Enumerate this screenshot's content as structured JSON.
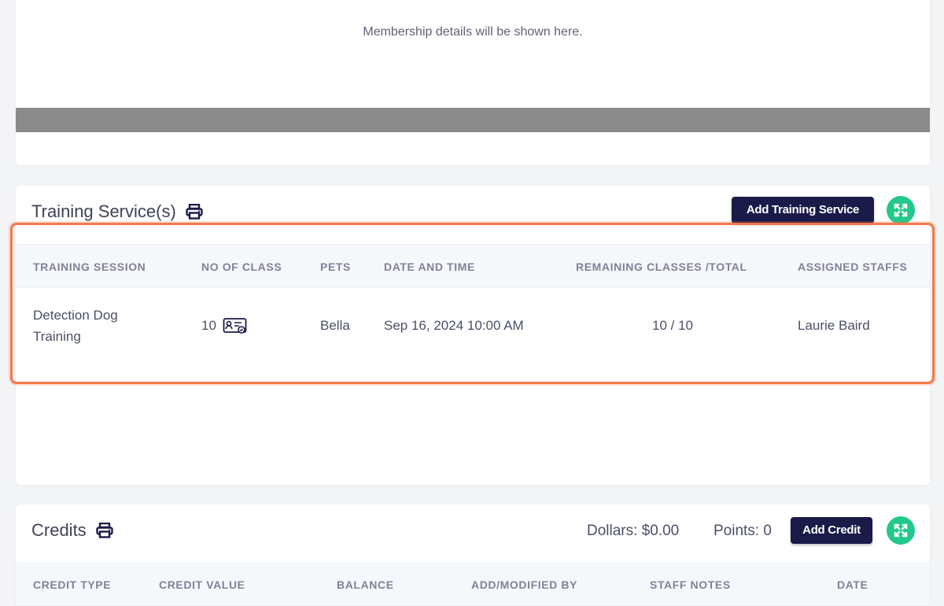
{
  "membership": {
    "message": "Membership details will be shown here."
  },
  "training": {
    "title": "Training Service(s)",
    "add_button": "Add Training Service",
    "columns": [
      "TRAINING SESSION",
      "NO OF CLASS",
      "PETS",
      "DATE AND TIME",
      "REMAINING CLASSES /TOTAL",
      "ASSIGNED STAFFS"
    ],
    "rows": [
      {
        "session_line1": "Detection Dog",
        "session_line2": "Training",
        "no_of_class": "10",
        "pets": "Bella",
        "date_time": "Sep 16, 2024 10:00 AM",
        "remaining_total": "10 / 10",
        "assigned_staff": "Laurie Baird"
      }
    ]
  },
  "credits": {
    "title": "Credits",
    "dollars": "Dollars: $0.00",
    "points": "Points: 0",
    "add_button": "Add Credit",
    "columns": [
      "CREDIT TYPE",
      "CREDIT VALUE",
      "BALANCE",
      "ADD/MODIFIED BY",
      "STAFF NOTES",
      "DATE"
    ]
  },
  "colors": {
    "primary_button": "#1b1b4a",
    "expand_button": "#22c98a",
    "highlight": "#f3784a"
  },
  "icons": [
    "print-icon",
    "expand-icon",
    "class-card-icon"
  ]
}
